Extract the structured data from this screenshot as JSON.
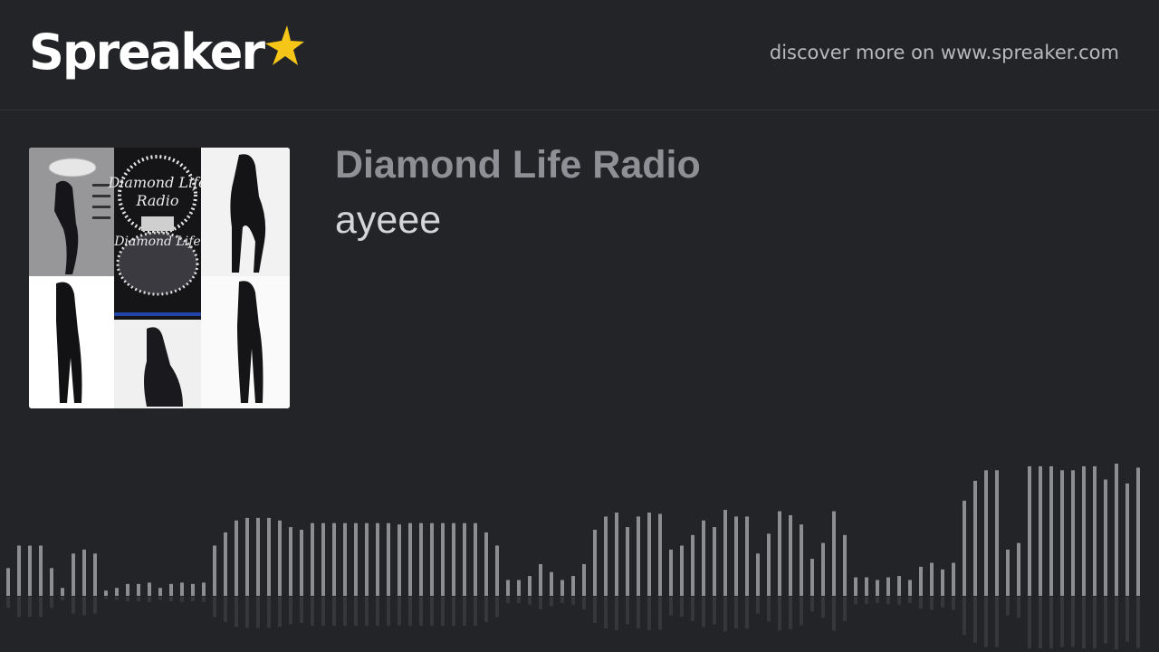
{
  "header": {
    "logo_text": "Spreaker",
    "star_color": "#f5c518",
    "discover_text": "discover more on www.spreaker.com"
  },
  "episode": {
    "show_title": "Diamond Life Radio",
    "episode_title": "ayeee",
    "cover_art": {
      "caption_text": "Diamond Life Radio",
      "background": "#ffffff"
    }
  },
  "waveform": {
    "bar_color": "#8d8e92",
    "levels": [
      0.21,
      0.38,
      0.38,
      0.38,
      0.21,
      0.06,
      0.32,
      0.35,
      0.32,
      0.04,
      0.06,
      0.09,
      0.09,
      0.1,
      0.06,
      0.09,
      0.1,
      0.09,
      0.1,
      0.38,
      0.48,
      0.57,
      0.59,
      0.59,
      0.59,
      0.57,
      0.52,
      0.5,
      0.55,
      0.55,
      0.55,
      0.55,
      0.55,
      0.55,
      0.55,
      0.55,
      0.54,
      0.55,
      0.55,
      0.55,
      0.55,
      0.55,
      0.55,
      0.55,
      0.48,
      0.38,
      0.12,
      0.12,
      0.15,
      0.24,
      0.18,
      0.12,
      0.15,
      0.24,
      0.5,
      0.6,
      0.63,
      0.52,
      0.6,
      0.63,
      0.62,
      0.35,
      0.38,
      0.46,
      0.57,
      0.52,
      0.65,
      0.6,
      0.6,
      0.32,
      0.47,
      0.64,
      0.61,
      0.54,
      0.28,
      0.4,
      0.64,
      0.46,
      0.14,
      0.14,
      0.12,
      0.14,
      0.15,
      0.12,
      0.22,
      0.25,
      0.2,
      0.25,
      0.72,
      0.87,
      0.95,
      0.95,
      0.35,
      0.4,
      0.98,
      0.98,
      0.98,
      0.95,
      0.95,
      0.98,
      0.98,
      0.88,
      1.0,
      0.85,
      0.97
    ]
  }
}
